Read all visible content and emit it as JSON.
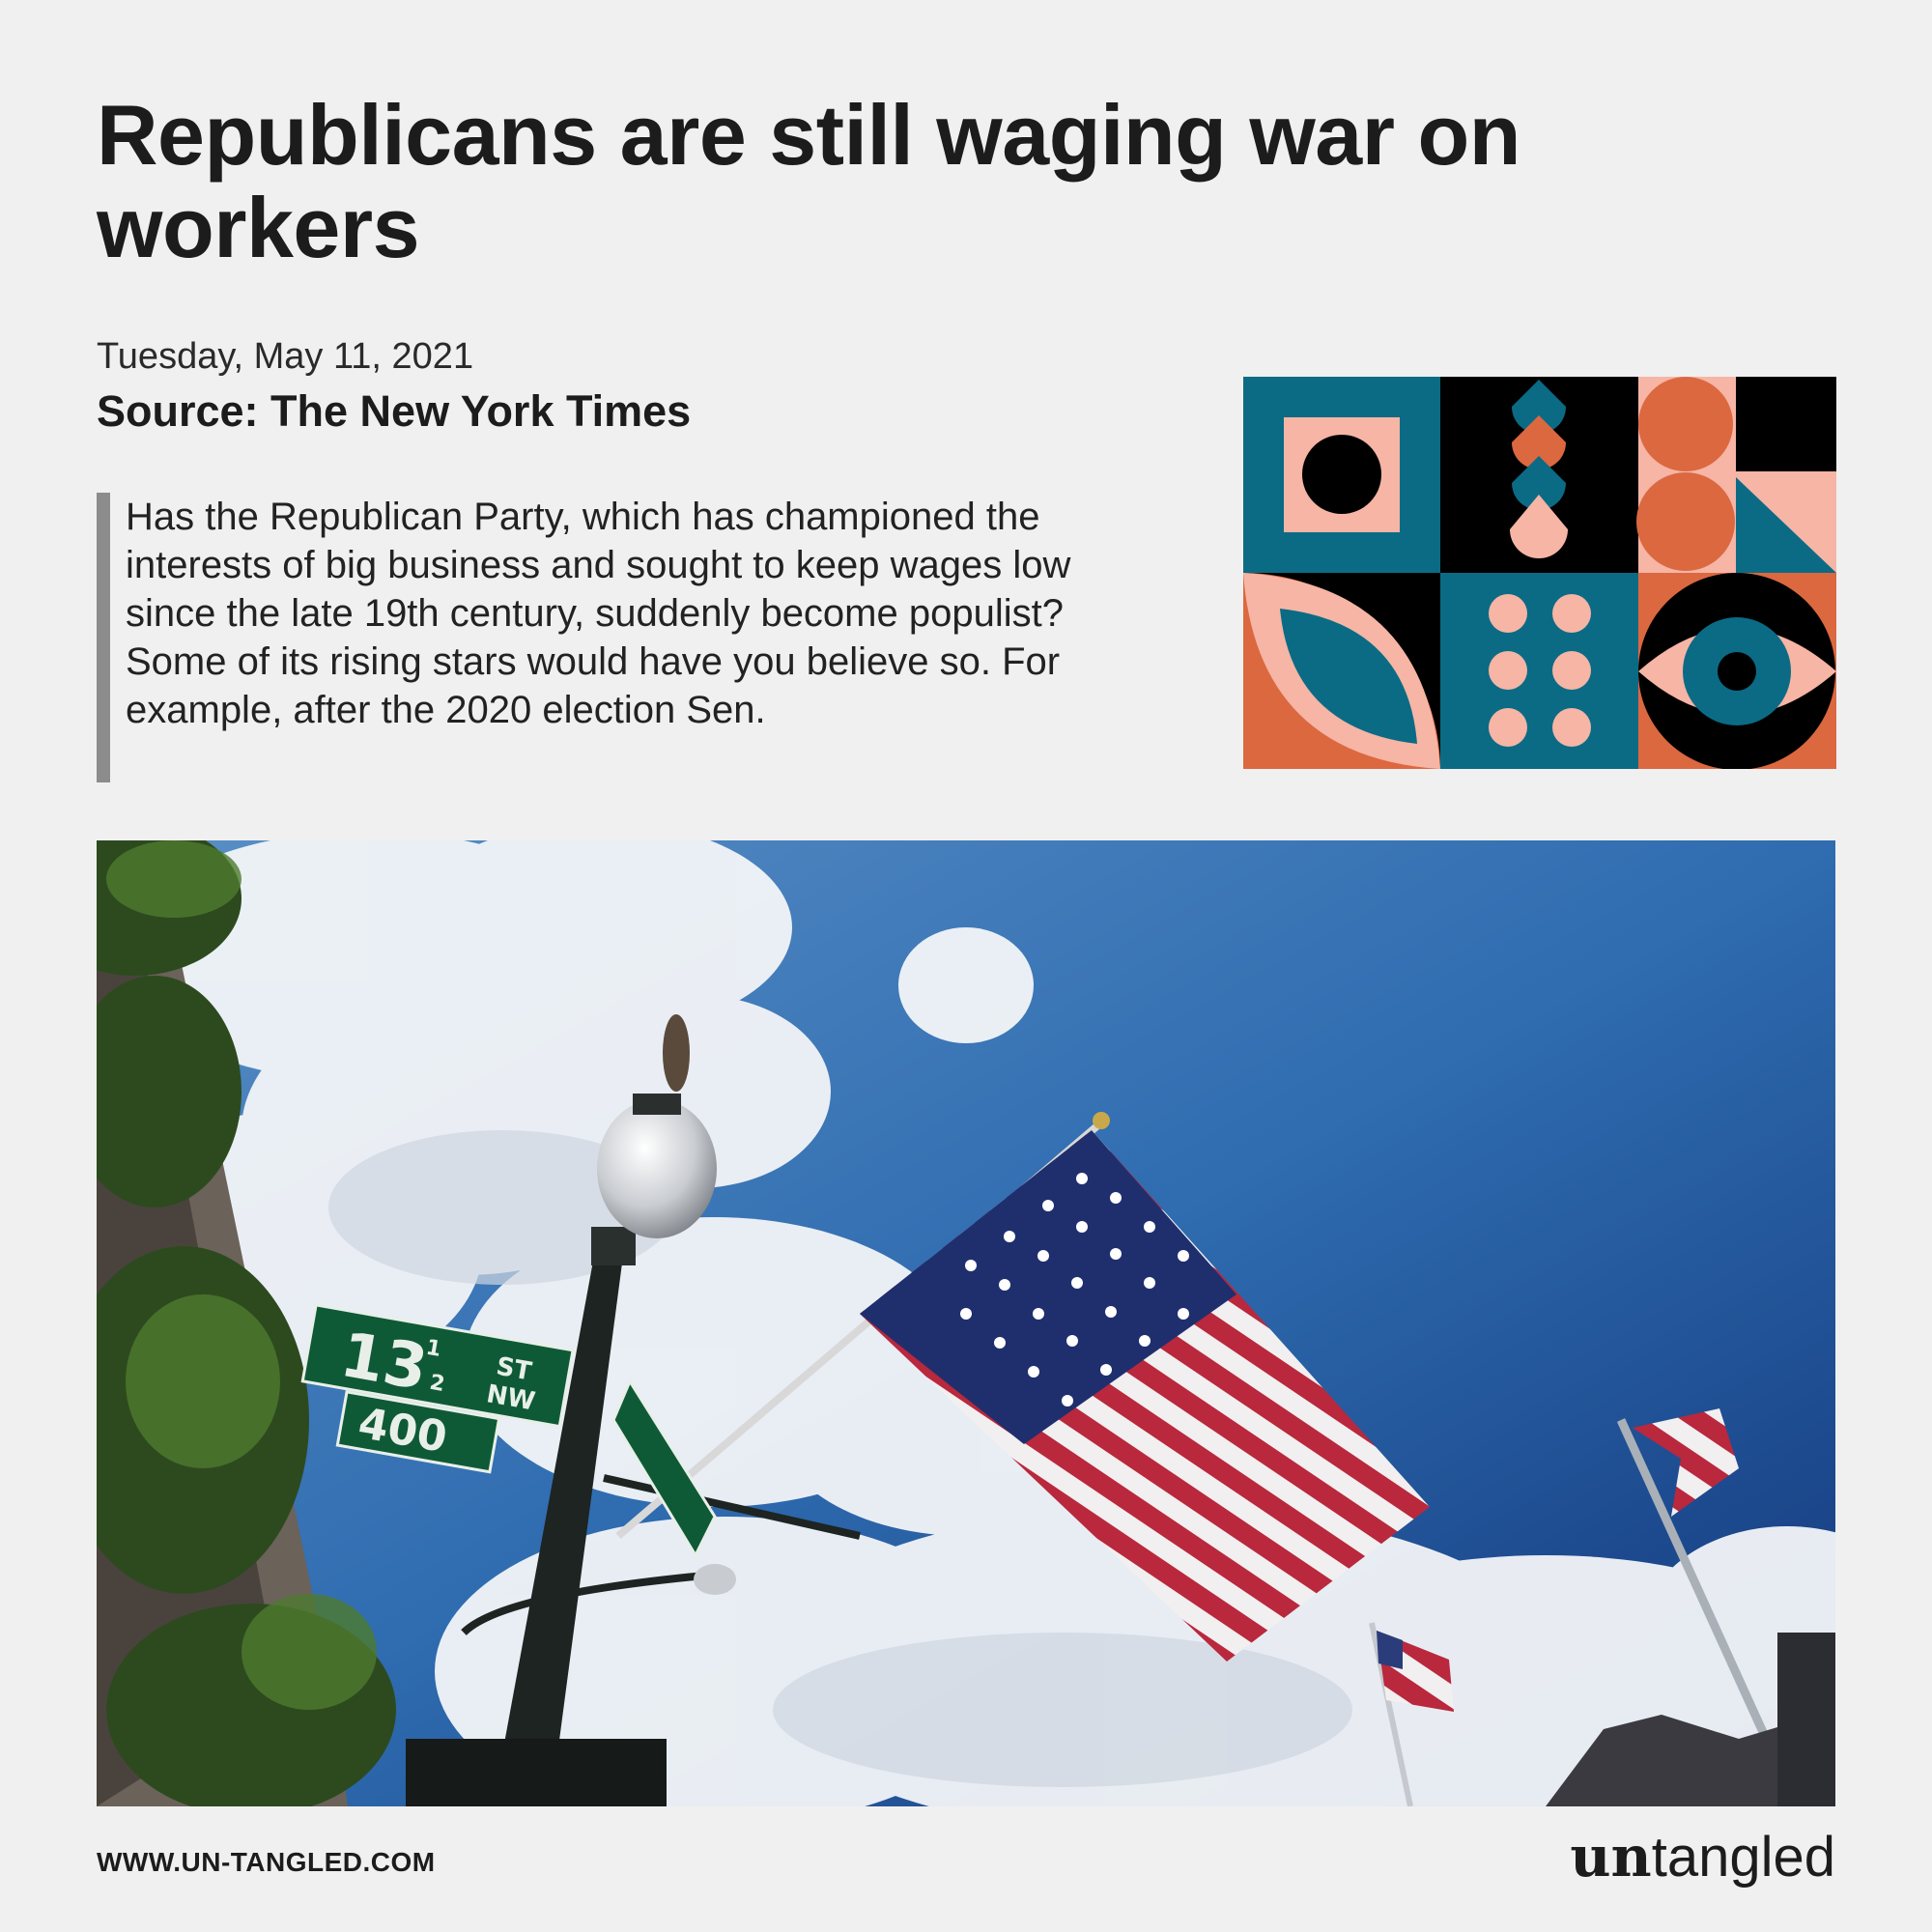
{
  "article": {
    "title": "Republicans are still waging war on workers",
    "date": "Tuesday, May 11, 2021",
    "source": "Source: The New York Times",
    "excerpt": "Has the Republican Party, which has championed the interests of big business and sought to keep wages low since the late 19th century, suddenly become populist? Some of its rising stars would have you believe so. For example, after the 2020 election Sen."
  },
  "photo": {
    "sign_number": "13",
    "sign_fraction_top": "1",
    "sign_fraction_bottom": "2",
    "sign_st": "ST",
    "sign_nw": "NW",
    "sign_block": "400"
  },
  "footer": {
    "url": "WWW.UN-TANGLED.COM",
    "logo_bold": "un",
    "logo_light": "tangled"
  },
  "colors": {
    "background": "#f0f0f0",
    "teal": "#0b6b85",
    "coral": "#dc6840",
    "pink": "#f6b5a5",
    "black": "#000000",
    "accent_bar": "#8c8c8c"
  }
}
